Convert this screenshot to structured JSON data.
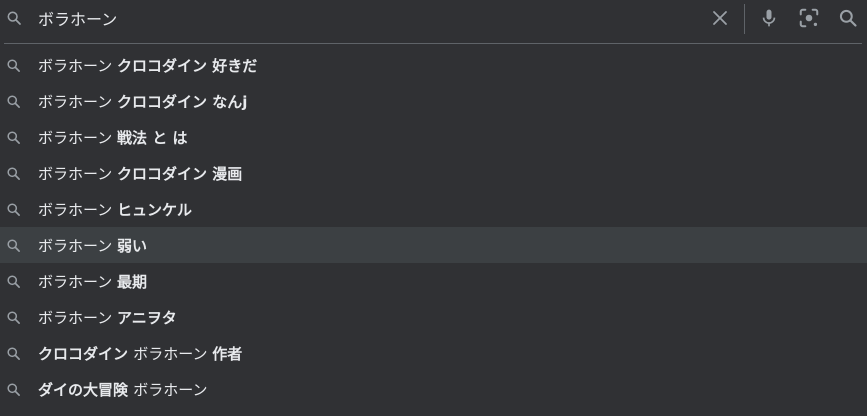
{
  "search": {
    "query": "ボラホーン"
  },
  "icons": {
    "search": "search-icon",
    "clear": "close-icon",
    "mic": "microphone-icon",
    "lens": "camera-lens-icon"
  },
  "colors": {
    "background": "#303134",
    "highlight": "#3c4043",
    "text": "#e8eaed",
    "icon": "#9aa0a6",
    "divider": "#5f6368"
  },
  "suggestions": [
    {
      "normal": "ボラホーン ",
      "bold": "クロコダイン 好きだ",
      "bold_first": false
    },
    {
      "normal": "ボラホーン ",
      "bold": "クロコダイン なんj",
      "bold_first": false
    },
    {
      "normal": "ボラホーン ",
      "bold": "戦法 と は",
      "bold_first": false
    },
    {
      "normal": "ボラホーン ",
      "bold": "クロコダイン 漫画",
      "bold_first": false
    },
    {
      "normal": "ボラホーン ",
      "bold": "ヒュンケル",
      "bold_first": false
    },
    {
      "normal": "ボラホーン ",
      "bold": "弱い",
      "bold_first": false
    },
    {
      "normal": "ボラホーン ",
      "bold": "最期",
      "bold_first": false
    },
    {
      "normal": "ボラホーン ",
      "bold": "アニヲタ",
      "bold_first": false
    },
    {
      "bold": "クロコダイン ",
      "normal": "ボラホーン ",
      "bold2": "作者",
      "bold_first": true
    },
    {
      "bold": "ダイの大冒険 ",
      "normal": "ボラホーン",
      "bold2": "",
      "bold_first": true
    }
  ],
  "highlighted_index": 5
}
